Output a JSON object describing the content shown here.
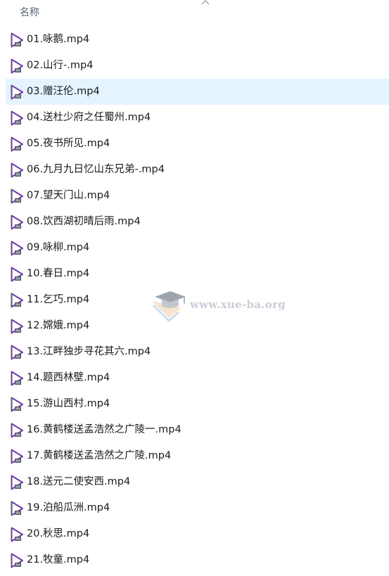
{
  "header": {
    "name_column_label": "名称"
  },
  "files": [
    {
      "name": "01.咏鹅.mp4",
      "selected": false
    },
    {
      "name": "02.山行-.mp4",
      "selected": false
    },
    {
      "name": "03.赠汪伦.mp4",
      "selected": true
    },
    {
      "name": "04.送杜少府之任蜀州.mp4",
      "selected": false
    },
    {
      "name": "05.夜书所见.mp4",
      "selected": false
    },
    {
      "name": "06.九月九日忆山东兄弟-.mp4",
      "selected": false
    },
    {
      "name": "07.望天门山.mp4",
      "selected": false
    },
    {
      "name": "08.饮西湖初晴后雨.mp4",
      "selected": false
    },
    {
      "name": "09.咏柳.mp4",
      "selected": false
    },
    {
      "name": "10.春日.mp4",
      "selected": false
    },
    {
      "name": "11.乞巧.mp4",
      "selected": false
    },
    {
      "name": "12.嫦娥.mp4",
      "selected": false
    },
    {
      "name": "13.江畔独步寻花其六.mp4",
      "selected": false
    },
    {
      "name": "14.题西林壁.mp4",
      "selected": false
    },
    {
      "name": "15.游山西村.mp4",
      "selected": false
    },
    {
      "name": "16.黄鹤楼送孟浩然之广陵一.mp4",
      "selected": false
    },
    {
      "name": "17.黄鹤楼送孟浩然之广陵.mp4",
      "selected": false
    },
    {
      "name": "18.送元二使安西.mp4",
      "selected": false
    },
    {
      "name": "19.泊船瓜洲.mp4",
      "selected": false
    },
    {
      "name": "20.秋思.mp4",
      "selected": false
    },
    {
      "name": "21.牧童.mp4",
      "selected": false
    }
  ],
  "watermark": {
    "text": "www.xue-ba.org"
  },
  "colors": {
    "selected_row": "#e5f3ff",
    "icon_purple": "#6b3fa0",
    "header_text": "#5a6270"
  },
  "icons": {
    "file_icon": "video-file-play-icon",
    "sort_icon": "chevron-up-icon"
  }
}
